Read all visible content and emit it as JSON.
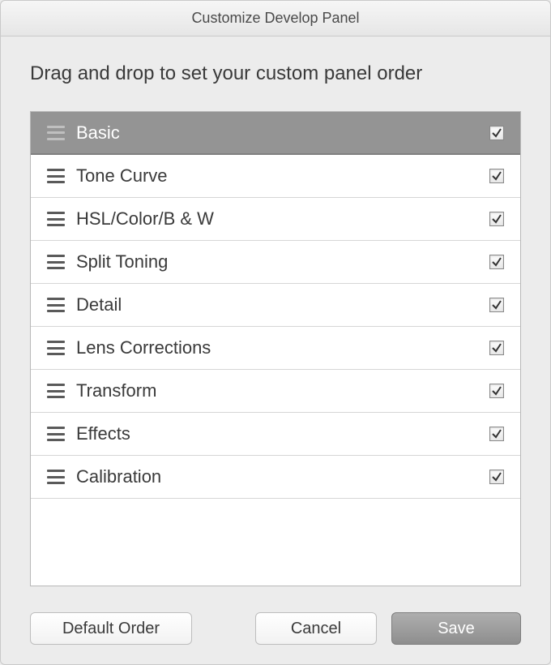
{
  "window": {
    "title": "Customize Develop Panel"
  },
  "instruction": "Drag and drop to set your custom panel order",
  "panels": [
    {
      "label": "Basic",
      "checked": true,
      "selected": true
    },
    {
      "label": "Tone Curve",
      "checked": true,
      "selected": false
    },
    {
      "label": "HSL/Color/B & W",
      "checked": true,
      "selected": false
    },
    {
      "label": "Split Toning",
      "checked": true,
      "selected": false
    },
    {
      "label": "Detail",
      "checked": true,
      "selected": false
    },
    {
      "label": "Lens Corrections",
      "checked": true,
      "selected": false
    },
    {
      "label": "Transform",
      "checked": true,
      "selected": false
    },
    {
      "label": "Effects",
      "checked": true,
      "selected": false
    },
    {
      "label": "Calibration",
      "checked": true,
      "selected": false
    }
  ],
  "buttons": {
    "default_order": "Default Order",
    "cancel": "Cancel",
    "save": "Save"
  }
}
